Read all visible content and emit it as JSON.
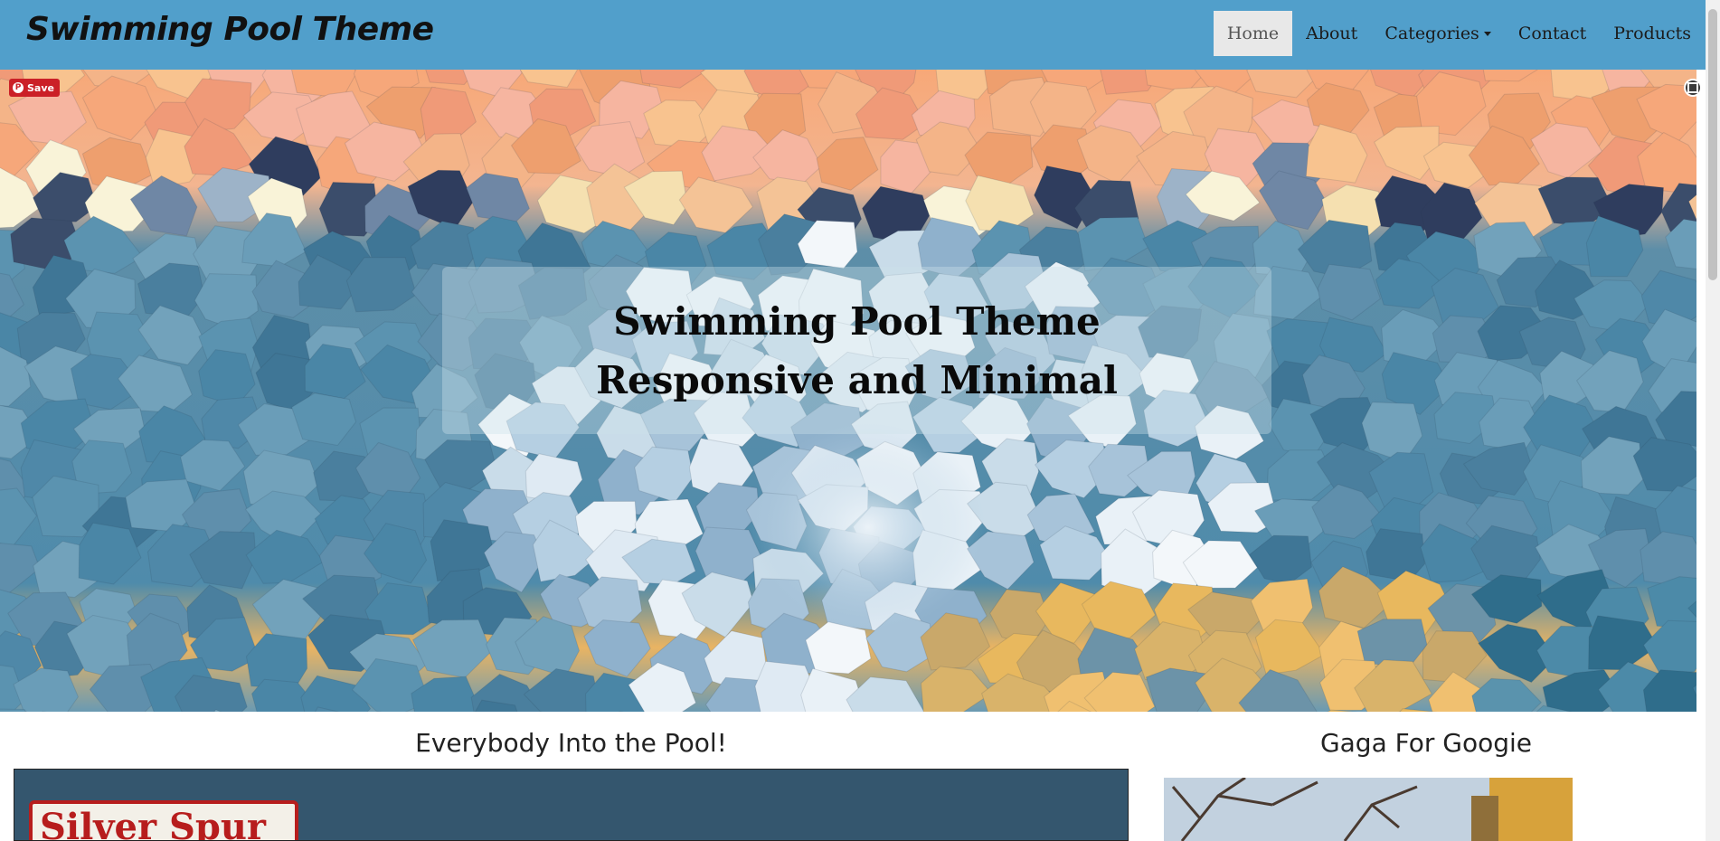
{
  "brand": "Swimming Pool Theme",
  "nav": {
    "home": "Home",
    "about": "About",
    "categories": "Categories",
    "contact": "Contact",
    "products": "Products"
  },
  "hero": {
    "line1": "Swimming Pool Theme",
    "line2": "Responsive and Minimal",
    "pin_save": "Save"
  },
  "main": {
    "post_title": "Everybody Into the Pool!",
    "sign_text": "Silver Spur"
  },
  "sidebar": {
    "widget_title": "Gaga For Googie"
  },
  "colors": {
    "navbar": "#519fcb",
    "pin": "#cb2027",
    "active_nav_bg": "#e8e8e8"
  }
}
